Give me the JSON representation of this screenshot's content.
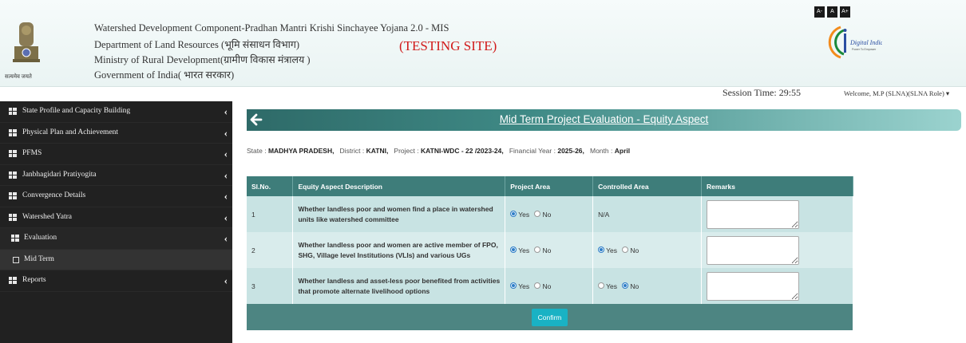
{
  "header": {
    "line1": "Watershed Development Component-Pradhan Mantri Krishi Sinchayee Yojana 2.0 - MIS",
    "line2": "Department of Land Resources (भूमि संसाधन विभाग)",
    "line3": "Ministry of Rural Development(ग्रामीण विकास मंत्रालय )",
    "line4": "Government of India( भारत सरकार)",
    "testing": "(TESTING SITE)",
    "emblem_caption": "सत्यमेव जयते",
    "font_controls": [
      "A-",
      "A",
      "A+"
    ],
    "session": "Session Time: 29:55",
    "welcome": "Welcome, M.P (SLNA)(SLNA Role) ▾"
  },
  "sidebar": {
    "items": [
      {
        "label": "State Profile and Capacity Building"
      },
      {
        "label": "Physical Plan and Achievement"
      },
      {
        "label": "PFMS"
      },
      {
        "label": "Janbhagidari Pratiyogita"
      },
      {
        "label": "Convergence Details"
      },
      {
        "label": "Watershed Yatra"
      },
      {
        "label": "Evaluation"
      },
      {
        "label": "Mid Term"
      },
      {
        "label": "Reports"
      }
    ]
  },
  "page": {
    "title": "Mid Term Project Evaluation - Equity Aspect",
    "info": {
      "state_label": "State :",
      "state": "MADHYA PRADESH,",
      "district_label": "District :",
      "district": "KATNI,",
      "project_label": "Project :",
      "project": "KATNI-WDC - 22 /2023-24,",
      "fy_label": "Financial Year :",
      "fy": "2025-26,",
      "month_label": "Month :",
      "month": "April"
    }
  },
  "table": {
    "headers": [
      "Sl.No.",
      "Equity Aspect Description",
      "Project Area",
      "Controlled Area",
      "Remarks"
    ],
    "rows": [
      {
        "sl": "1",
        "desc": "Whether landless poor and women find a place in watershed units like watershed committee",
        "project": "Yes",
        "controlled_na": "N/A"
      },
      {
        "sl": "2",
        "desc": "Whether landless poor and women are active member of FPO, SHG, Village level Institutions (VLIs) and various UGs",
        "project": "Yes",
        "controlled": "Yes"
      },
      {
        "sl": "3",
        "desc": "Whether landless and asset-less poor benefited from activities that promote alternate livelihood options",
        "project": "Yes",
        "controlled": "No"
      }
    ],
    "yes_label": "Yes",
    "no_label": "No",
    "confirm": "Confirm"
  },
  "colors": {
    "sidebar_bg": "#212121",
    "header_teal": "#3e7d7a",
    "testing_red": "#d11a1a",
    "confirm_bg": "#19b2c4"
  }
}
